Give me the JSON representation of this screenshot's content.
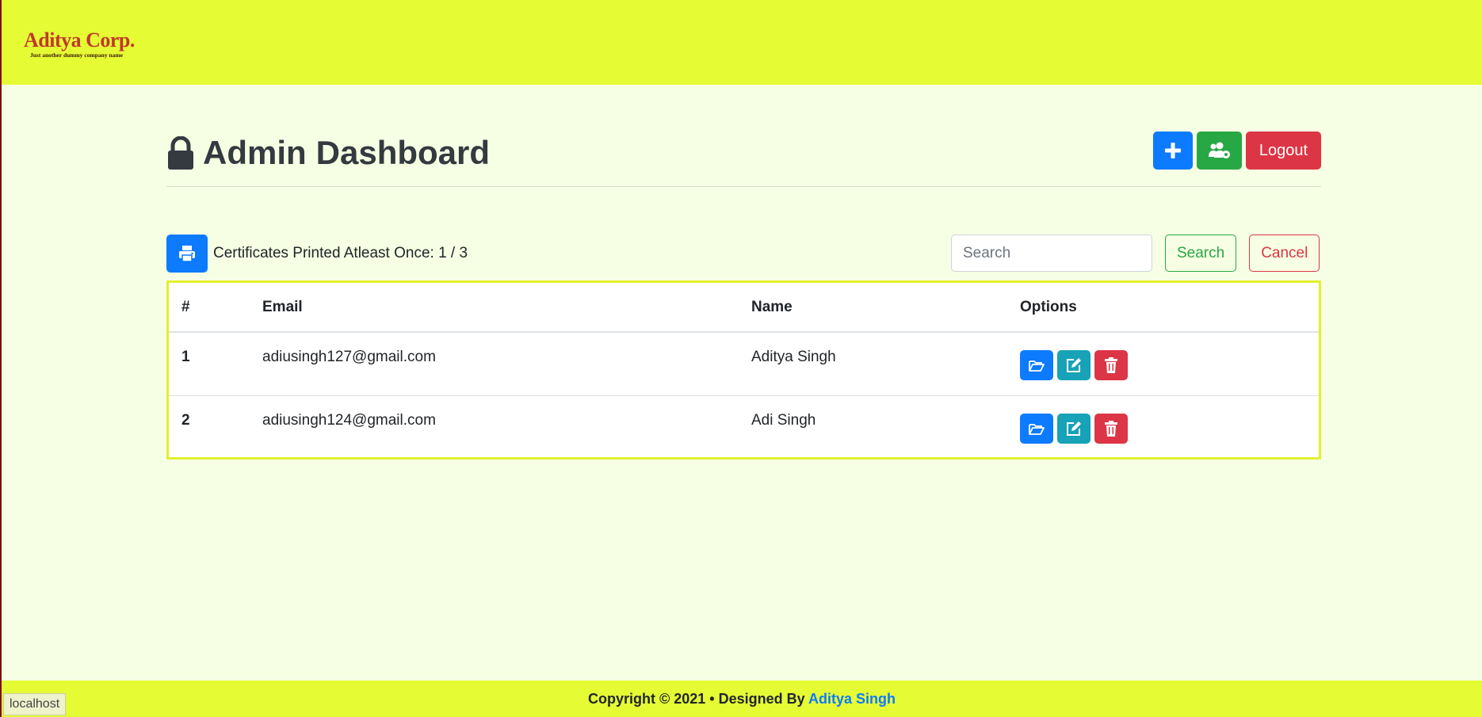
{
  "brand": {
    "name": "Aditya Corp.",
    "tagline": "Just another dummy company name"
  },
  "header": {
    "title_bold": "Admin",
    "title_rest": "Dashboard",
    "logout_label": "Logout"
  },
  "stats": {
    "label": "Certificates Printed Atleast Once: 1 / 3"
  },
  "search": {
    "placeholder": "Search",
    "search_label": "Search",
    "cancel_label": "Cancel"
  },
  "table": {
    "columns": [
      "#",
      "Email",
      "Name",
      "Options"
    ],
    "rows": [
      {
        "num": "1",
        "email": "adiusingh127@gmail.com",
        "name": "Aditya Singh"
      },
      {
        "num": "2",
        "email": "adiusingh124@gmail.com",
        "name": "Adi Singh"
      }
    ]
  },
  "footer": {
    "text": "Copyright © 2021 • Designed By",
    "author": "Aditya Singh"
  },
  "status_bar": {
    "url": "localhost"
  },
  "icons": {
    "lock": "lock-icon",
    "add": "plus-icon",
    "users": "users-cog-icon",
    "print": "print-icon",
    "open": "folder-open-icon",
    "edit": "edit-icon",
    "delete": "trash-icon"
  },
  "colors": {
    "header_bg": "#e5fb34",
    "page_bg": "#f6ffe3",
    "primary": "#0d7bfd",
    "success": "#28a745",
    "danger": "#dc3545",
    "info": "#17a2b8"
  }
}
